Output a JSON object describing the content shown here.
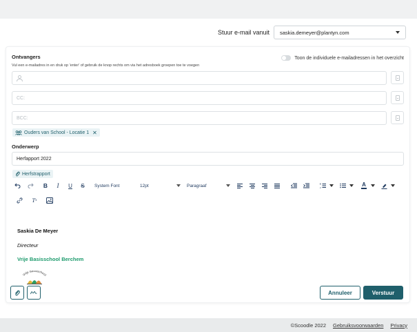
{
  "sender": {
    "label": "Stuur e-mail vanuit",
    "value": "saskia.demeyer@plantyn.com"
  },
  "recipients": {
    "heading": "Ontvangers",
    "hint": "Vul een e-mailadres in en druk op 'enter' of gebruik de knop rechts om via het adresboek groepen toe te voegen",
    "toggle_label": "Toon de individuele e-mailadressen in het overzicht",
    "to_placeholder": "",
    "cc_placeholder": "CC:",
    "bcc_placeholder": "BCC:",
    "group_tag": "Ouders van School - Locatie 1"
  },
  "subject": {
    "heading": "Onderwerp",
    "value": "Herfapport 2022"
  },
  "attachment": {
    "name": "Herfstrapport"
  },
  "toolbar": {
    "font_family": "System Font",
    "font_size": "12pt",
    "block_format": "Paragraaf"
  },
  "signature": {
    "name": "Saskia De Meyer",
    "title": "Directeur",
    "school": "Vrije Basisschool Berchem",
    "logo_text": "Vrije Basisschool"
  },
  "actions": {
    "cancel": "Annuleer",
    "send": "Verstuur"
  },
  "footer": {
    "copyright": "©Scoodle 2022",
    "terms": "Gebruiksvoorwaarden",
    "privacy": "Privacy"
  },
  "colors": {
    "primary": "#1f5f6b",
    "school_green": "#1c9a6c",
    "toolbar_ink": "#1f3a5f"
  },
  "icons": [
    "undo-icon",
    "redo-icon",
    "bold-icon",
    "italic-icon",
    "underline-icon",
    "strikethrough-icon",
    "align-left-icon",
    "align-center-icon",
    "align-right-icon",
    "align-justify-icon",
    "outdent-icon",
    "indent-icon",
    "numbered-list-icon",
    "bullet-list-icon",
    "text-color-icon",
    "highlight-icon",
    "link-icon",
    "clear-format-icon",
    "image-icon",
    "paperclip-icon",
    "signature-icon",
    "address-book-icon",
    "group-icon"
  ]
}
